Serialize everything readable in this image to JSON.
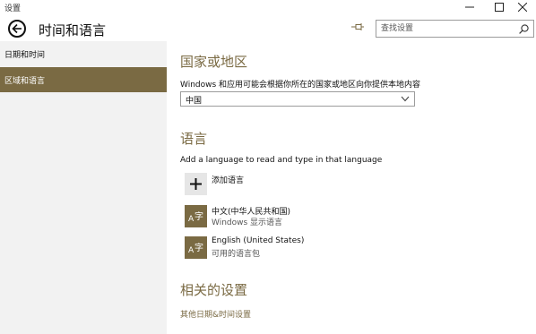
{
  "window": {
    "title": "设置"
  },
  "header": {
    "title": "时间和语言",
    "search_placeholder": "查找设置"
  },
  "sidebar": {
    "items": [
      {
        "label": "日期和时间",
        "active": false
      },
      {
        "label": "区域和语言",
        "active": true
      }
    ]
  },
  "region": {
    "title": "国家或地区",
    "description": "Windows 和应用可能会根据你所在的国家或地区向你提供本地内容",
    "selected": "中国"
  },
  "language": {
    "title": "语言",
    "description": "Add a language to read and type in that language",
    "add_label": "添加语言",
    "languages": [
      {
        "name": "中文(中华人民共和国)",
        "sub": "Windows 显示语言"
      },
      {
        "name": "English (United States)",
        "sub": "可用的语言包"
      }
    ]
  },
  "related": {
    "title": "相关的设置",
    "link": "其他日期&时间设置"
  },
  "colors": {
    "accent": "#7a6a43",
    "sidebar_bg": "#f2f2f2"
  },
  "icons": [
    "back-arrow-icon",
    "pin-icon",
    "search-icon",
    "chevron-down-icon",
    "plus-icon",
    "language-icon",
    "minimize-icon",
    "maximize-icon",
    "close-icon"
  ]
}
